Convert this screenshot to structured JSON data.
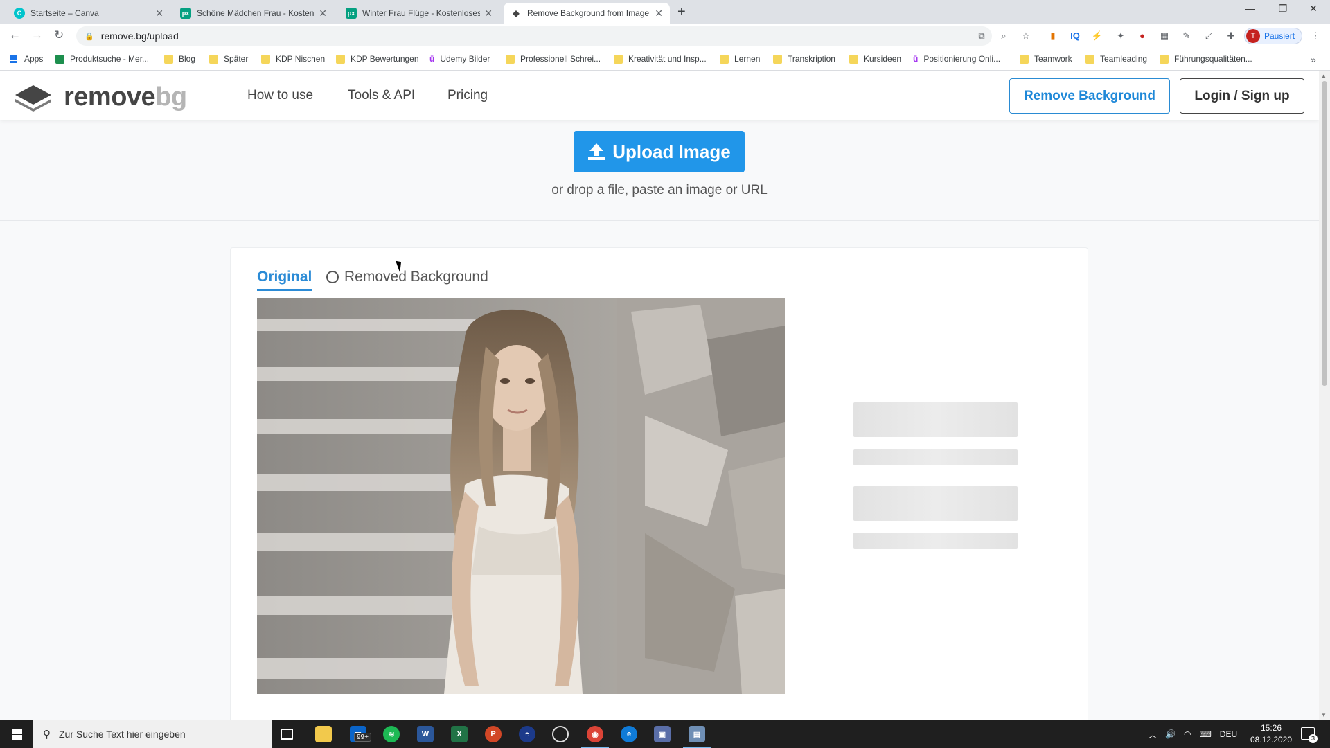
{
  "browser": {
    "tabs": [
      {
        "title": "Startseite – Canva",
        "favicon": "canva-icon",
        "color": "#00c4cc",
        "glyph": "C"
      },
      {
        "title": "Schöne Mädchen Frau - Kostenlo",
        "favicon": "pexels-icon",
        "color": "#05a081",
        "glyph": "px"
      },
      {
        "title": "Winter Frau Flüge - Kostenloses",
        "favicon": "pexels-icon",
        "color": "#05a081",
        "glyph": "px"
      },
      {
        "title": "Remove Background from Image",
        "favicon": "removebg-icon",
        "color": "#454545",
        "glyph": "◆"
      }
    ],
    "url": "remove.bg/upload",
    "profile_label": "Pausiert",
    "profile_initial": "T",
    "bookmarks": [
      {
        "label": "Apps",
        "icon": "apps-grid-icon"
      },
      {
        "label": "Produktsuche - Mer...",
        "icon": "merch-icon"
      },
      {
        "label": "Blog",
        "icon": "folder-icon"
      },
      {
        "label": "Später",
        "icon": "folder-icon"
      },
      {
        "label": "KDP Nischen",
        "icon": "folder-icon"
      },
      {
        "label": "KDP Bewertungen",
        "icon": "folder-icon"
      },
      {
        "label": "Udemy Bilder",
        "icon": "udemy-icon"
      },
      {
        "label": "Professionell Schrei...",
        "icon": "folder-icon"
      },
      {
        "label": "Kreativität und Insp...",
        "icon": "folder-icon"
      },
      {
        "label": "Lernen",
        "icon": "folder-icon"
      },
      {
        "label": "Transkription",
        "icon": "folder-icon"
      },
      {
        "label": "Kursideen",
        "icon": "folder-icon"
      },
      {
        "label": "Positionierung Onli...",
        "icon": "udemy-icon"
      },
      {
        "label": "Teamwork",
        "icon": "folder-icon"
      },
      {
        "label": "Teamleading",
        "icon": "folder-icon"
      },
      {
        "label": "Führungsqualitäten...",
        "icon": "folder-icon"
      }
    ]
  },
  "site": {
    "logo_word1": "remove",
    "logo_word2": "bg",
    "nav": {
      "how_to_use": "How to use",
      "tools_api": "Tools & API",
      "pricing": "Pricing"
    },
    "remove_background_button": "Remove Background",
    "login_button": "Login / Sign up",
    "upload_button": "Upload Image",
    "drop_hint_prefix": "or drop a file, paste an image or",
    "drop_hint_link": "URL",
    "tab_original": "Original",
    "tab_removed": "Removed Background",
    "accent_color": "#2196e9"
  },
  "taskbar": {
    "search_placeholder": "Zur Suche Text hier eingeben",
    "mail_badge": "99+",
    "language": "DEU",
    "time": "15:26",
    "date": "08.12.2020",
    "notifications": "3"
  }
}
